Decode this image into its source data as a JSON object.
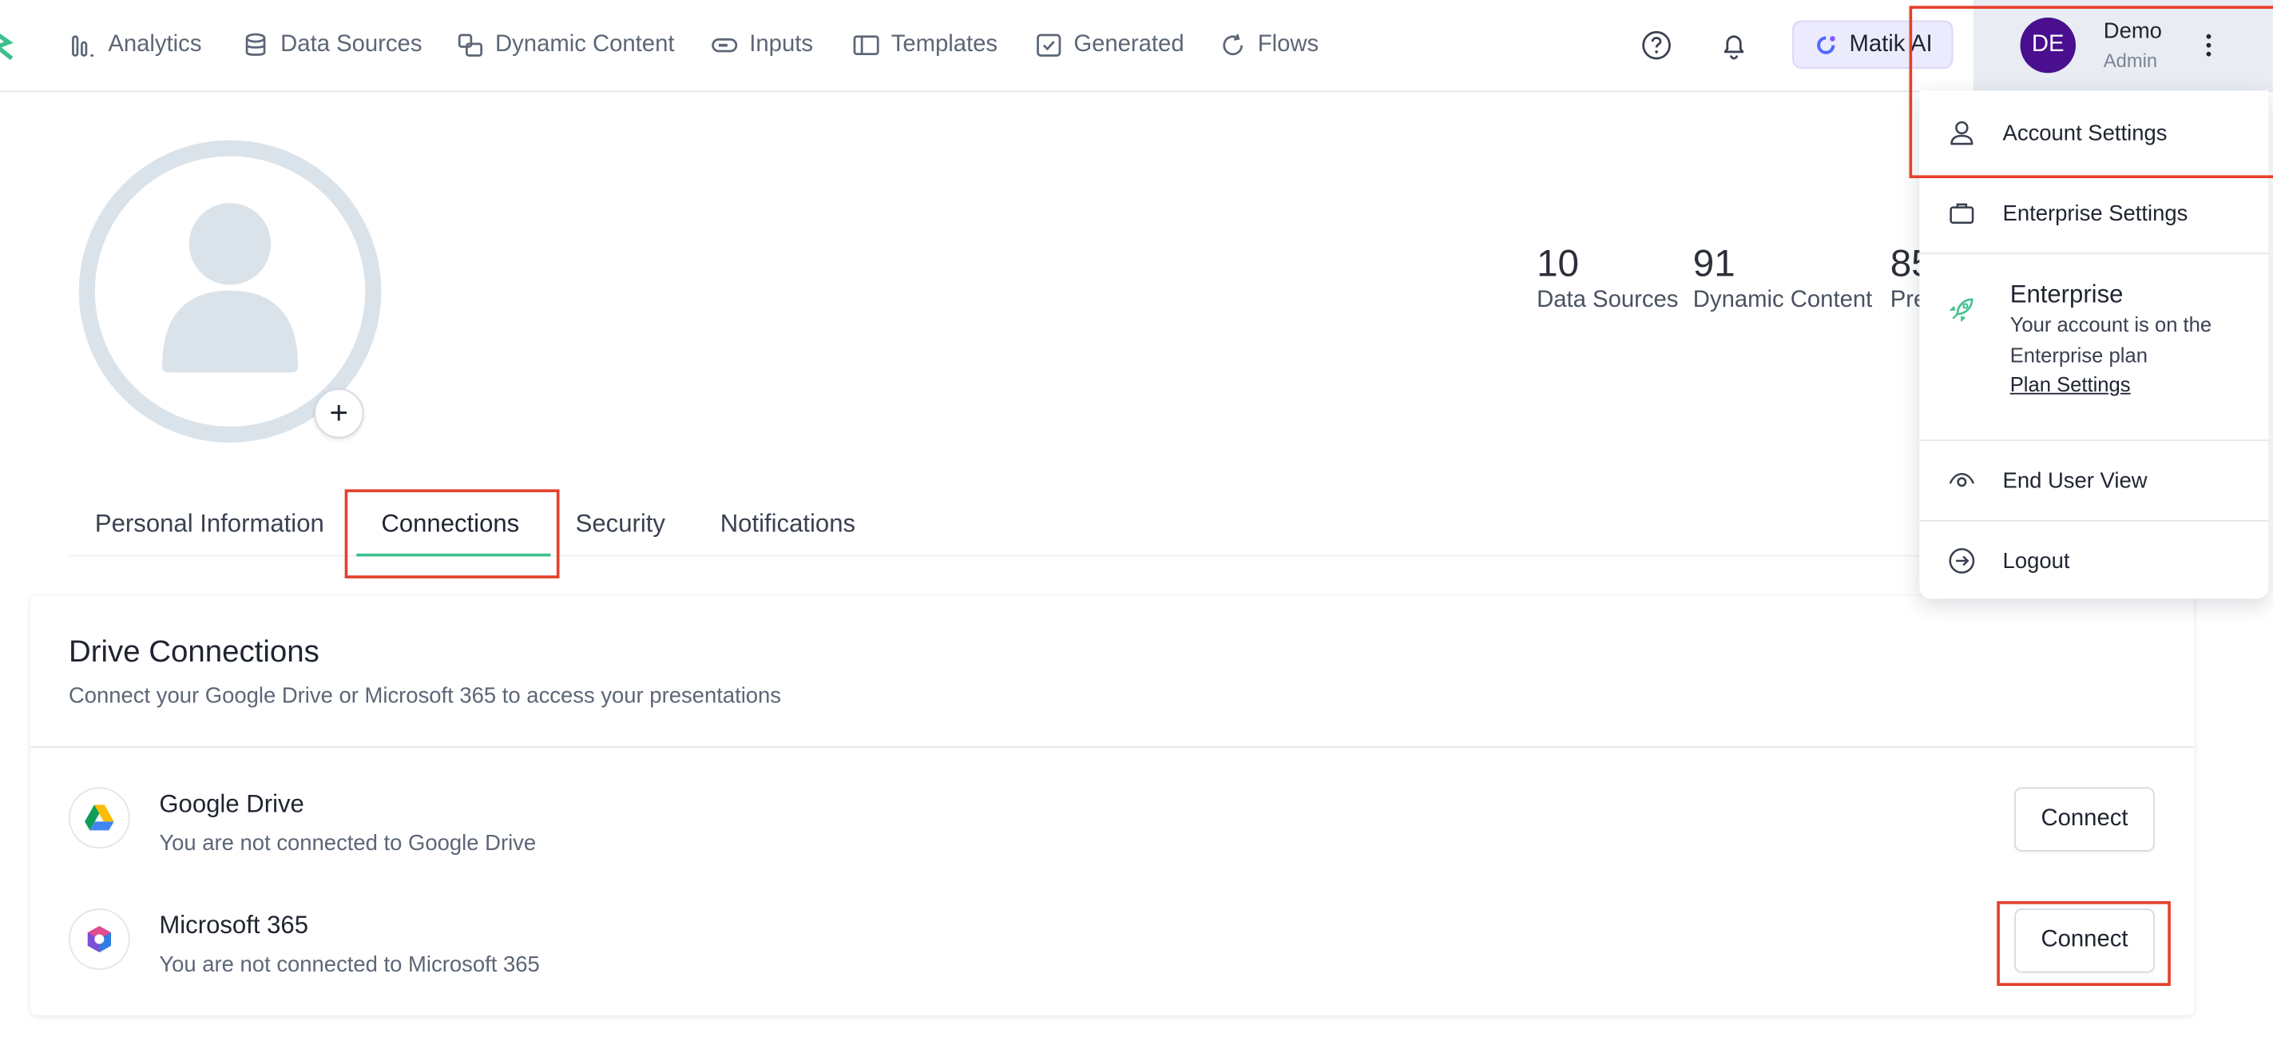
{
  "nav": {
    "items": [
      {
        "label": "Analytics",
        "icon": "bar-chart-icon"
      },
      {
        "label": "Data Sources",
        "icon": "database-icon"
      },
      {
        "label": "Dynamic Content",
        "icon": "dynamic-content-icon"
      },
      {
        "label": "Inputs",
        "icon": "input-icon"
      },
      {
        "label": "Templates",
        "icon": "template-icon"
      },
      {
        "label": "Generated",
        "icon": "check-square-icon"
      },
      {
        "label": "Flows",
        "icon": "refresh-icon"
      }
    ],
    "ai_label": "Matik AI",
    "user": {
      "initials": "DE",
      "name": "Demo",
      "role": "Admin"
    }
  },
  "stats": [
    {
      "value": "10",
      "label": "Data Sources"
    },
    {
      "value": "91",
      "label": "Dynamic Content"
    },
    {
      "value": "85",
      "label": "Pre"
    }
  ],
  "tabs": [
    "Personal Information",
    "Connections",
    "Security",
    "Notifications"
  ],
  "active_tab": "Connections",
  "drive": {
    "title": "Drive Connections",
    "subtitle": "Connect your Google Drive or Microsoft 365 to access your presentations",
    "services": [
      {
        "name": "Google Drive",
        "status": "You are not connected to Google Drive",
        "button": "Connect"
      },
      {
        "name": "Microsoft 365",
        "status": "You are not connected to Microsoft 365",
        "button": "Connect"
      }
    ]
  },
  "menu": {
    "account_settings": "Account Settings",
    "enterprise_settings": "Enterprise Settings",
    "plan_title": "Enterprise",
    "plan_desc": "Your account is on the Enterprise plan",
    "plan_link": "Plan Settings",
    "end_user_view": "End User View",
    "logout": "Logout"
  },
  "colors": {
    "accent": "#3ec08d",
    "avatar_bg": "#4a0f8f",
    "highlight": "#e5412d"
  }
}
